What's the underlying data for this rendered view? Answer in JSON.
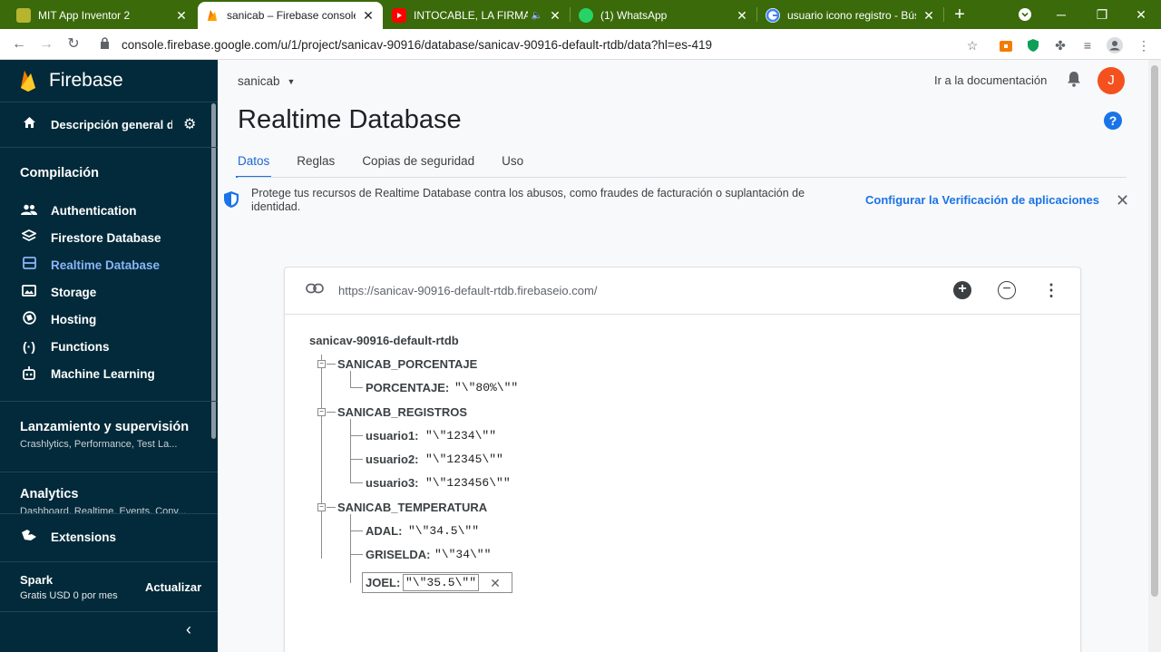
{
  "browser": {
    "tabs": [
      {
        "title": "MIT App Inventor 2",
        "active": false,
        "icon": "app-inventor-icon",
        "close": "✕"
      },
      {
        "title": "sanicab – Firebase console",
        "active": true,
        "icon": "firebase-icon",
        "close": "✕"
      },
      {
        "title": "INTOCABLE, LA FIRMA, PI",
        "active": false,
        "icon": "youtube-icon",
        "close": "✕",
        "audio": "🔈"
      },
      {
        "title": "(1) WhatsApp",
        "active": false,
        "icon": "whatsapp-icon",
        "close": "✕"
      },
      {
        "title": "usuario icono registro - Búsq",
        "active": false,
        "icon": "google-icon",
        "close": "✕"
      }
    ],
    "new_tab": "+",
    "url": "console.firebase.google.com/u/1/project/sanicav-90916/database/sanicav-90916-default-rtdb/data?hl=es-419",
    "colors": {
      "tabbar": "#3a6a0a"
    }
  },
  "sidebar": {
    "brand": "Firebase",
    "overview_label": "Descripción general del proyecto",
    "sections": {
      "build": "Compilación",
      "release": "Lanzamiento y supervisión",
      "release_sub": "Crashlytics, Performance, Test La...",
      "analytics": "Analytics",
      "analytics_sub": "Dashboard, Realtime, Events, Conv..."
    },
    "items": [
      {
        "label": "Authentication",
        "icon": "users-icon"
      },
      {
        "label": "Firestore Database",
        "icon": "firestore-icon"
      },
      {
        "label": "Realtime Database",
        "icon": "database-icon",
        "active": true
      },
      {
        "label": "Storage",
        "icon": "storage-icon"
      },
      {
        "label": "Hosting",
        "icon": "hosting-icon"
      },
      {
        "label": "Functions",
        "icon": "functions-icon"
      },
      {
        "label": "Machine Learning",
        "icon": "robot-icon"
      }
    ],
    "extensions": "Extensions",
    "plan": {
      "name": "Spark",
      "desc": "Gratis USD 0 por mes",
      "upgrade": "Actualizar"
    },
    "colors": {
      "bg": "#022a3a",
      "active": "#8ab4f8"
    }
  },
  "header": {
    "project": "sanicab",
    "docs_link": "Ir a la documentación",
    "avatar_letter": "J",
    "title": "Realtime Database",
    "help": "?"
  },
  "tabs": [
    "Datos",
    "Reglas",
    "Copias de seguridad",
    "Uso"
  ],
  "notice": {
    "text": "Protege tus recursos de Realtime Database contra los abusos, como fraudes de facturación o suplantación de identidad.",
    "cta": "Configurar la Verificación de aplicaciones"
  },
  "database": {
    "url": "https://sanicav-90916-default-rtdb.firebaseio.com/",
    "root": "sanicav-90916-default-rtdb",
    "groups": [
      {
        "key": "SANICAB_PORCENTAJE",
        "children": [
          {
            "key": "PORCENTAJE:",
            "value": "\"\\\"80%\\\"\""
          }
        ]
      },
      {
        "key": "SANICAB_REGISTROS",
        "children": [
          {
            "key": "usuario1:",
            "value": "\"\\\"1234\\\"\""
          },
          {
            "key": "usuario2:",
            "value": "\"\\\"12345\\\"\""
          },
          {
            "key": "usuario3:",
            "value": "\"\\\"123456\\\"\""
          }
        ]
      },
      {
        "key": "SANICAB_TEMPERATURA",
        "children": [
          {
            "key": "ADAL:",
            "value": "\"\\\"34.5\\\"\""
          },
          {
            "key": "GRISELDA:",
            "value": "\"\\\"34\\\"\""
          },
          {
            "key": "JOEL:",
            "value": "\"\\\"35.5\\\"\"",
            "editing": true
          }
        ]
      }
    ]
  }
}
